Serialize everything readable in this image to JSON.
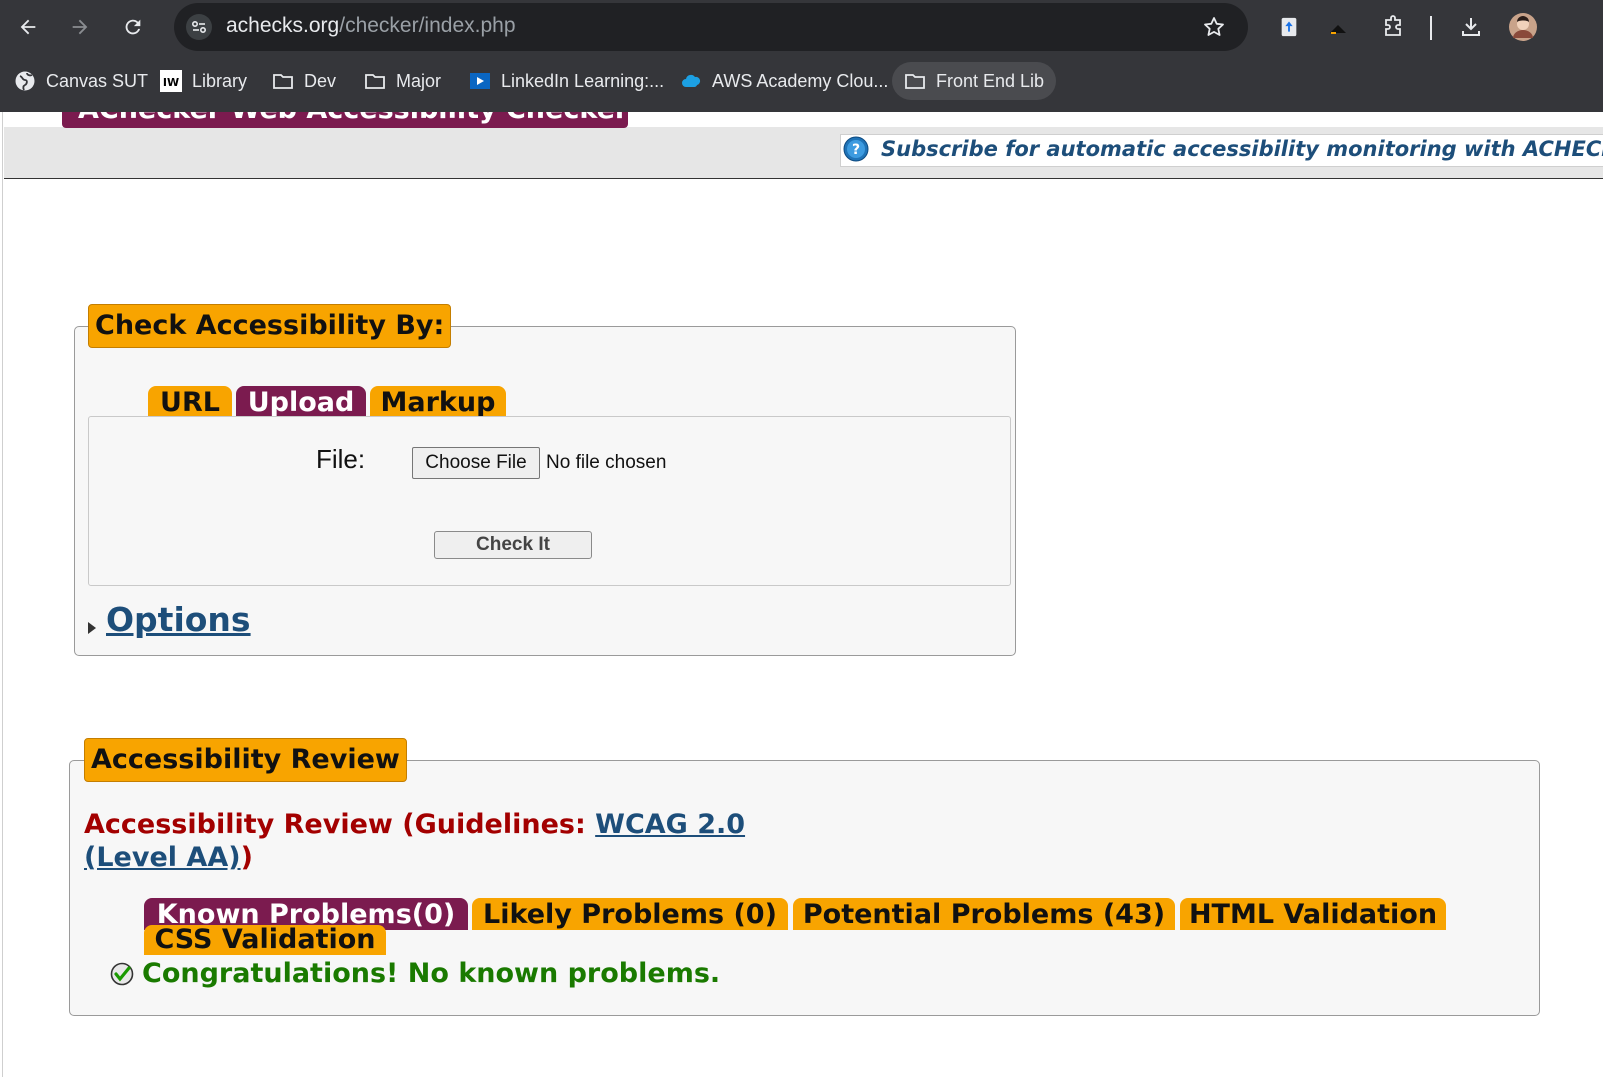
{
  "browser": {
    "url_host": "achecks.org",
    "url_path": "/checker/index.php",
    "bookmarks": [
      {
        "label": "Canvas SUT",
        "icon": "globe-icon"
      },
      {
        "label": "Library",
        "icon": "iw-icon"
      },
      {
        "label": "Dev",
        "icon": "folder-icon"
      },
      {
        "label": "Major",
        "icon": "folder-icon"
      },
      {
        "label": "LinkedIn Learning:...",
        "icon": "linkedin-learning-icon"
      },
      {
        "label": "AWS Academy Clou...",
        "icon": "cloud-icon"
      },
      {
        "label": "Front End Lib",
        "icon": "folder-icon"
      }
    ]
  },
  "header": {
    "title": "AChecker Web Accessibility Checker",
    "subscribe_text": "Subscribe for automatic accessibility monitoring with ACHECKS!"
  },
  "check": {
    "legend": "Check Accessibility By:",
    "tabs": [
      {
        "label": "URL",
        "active": false
      },
      {
        "label": "Upload",
        "active": true
      },
      {
        "label": "Markup",
        "active": false
      }
    ],
    "file_label": "File:",
    "choose_file_label": "Choose File",
    "no_file_text": "No file chosen",
    "check_button_label": "Check It",
    "options_label": "Options"
  },
  "review": {
    "legend": "Accessibility Review",
    "heading_prefix": "Accessibility Review (Guidelines: ",
    "guideline_link": "WCAG 2.0 (Level AA)",
    "heading_suffix": ")",
    "tabs": [
      {
        "label": "Known Problems(0)",
        "active": true
      },
      {
        "label": "Likely Problems (0)",
        "active": false
      },
      {
        "label": "Potential Problems (43)",
        "active": false
      },
      {
        "label": "HTML Validation",
        "active": false
      },
      {
        "label": "CSS Validation",
        "active": false
      }
    ],
    "result_message": "Congratulations! No known problems."
  },
  "colors": {
    "tab_orange": "#f8a400",
    "tab_purple": "#7b1b4f",
    "heading_red": "#a30000",
    "link_blue": "#1d4e7a",
    "success_green": "#1a7a00",
    "chrome_dark": "#35363a"
  }
}
